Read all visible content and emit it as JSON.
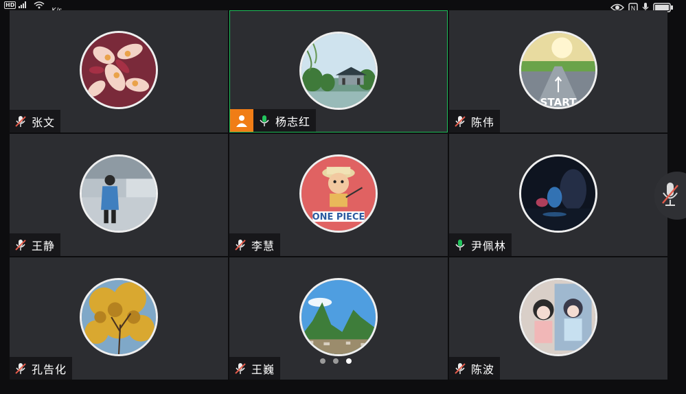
{
  "status_bar": {
    "hd_label": "HD",
    "speed": "K/s"
  },
  "colors": {
    "active_speaker_border": "#1fbf5a",
    "host_badge": "#f07d16",
    "mic_muted": "#e25b4b",
    "mic_on": "#23c45e",
    "tile_background": "#2c2d31"
  },
  "participants": [
    {
      "name": "张文",
      "mic": "muted",
      "avatar": "frangipani-flowers"
    },
    {
      "name": "杨志红",
      "mic": "on",
      "avatar": "lake-pavilion",
      "host": true,
      "active_speaker": true
    },
    {
      "name": "陈伟",
      "mic": "muted",
      "avatar": "start-road"
    },
    {
      "name": "王静",
      "mic": "muted",
      "avatar": "woman-blue-coat"
    },
    {
      "name": "李慧",
      "mic": "muted",
      "avatar": "one-piece-cartoon"
    },
    {
      "name": "尹佩林",
      "mic": "on",
      "avatar": "night-fountain"
    },
    {
      "name": "孔告化",
      "mic": "muted",
      "avatar": "ginkgo-tree"
    },
    {
      "name": "王巍",
      "mic": "muted",
      "avatar": "karst-mountains"
    },
    {
      "name": "陈波",
      "mic": "muted",
      "avatar": "illustrated-girls"
    }
  ],
  "pagination": {
    "pages": 3,
    "current": 3
  },
  "self_mic": "muted"
}
